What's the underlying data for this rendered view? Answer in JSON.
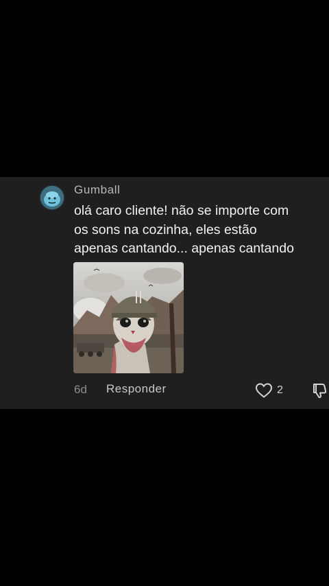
{
  "comment": {
    "username": "Gumball",
    "text_lines": [
      "olá caro cliente! não se importe com",
      "os sons na cozinha, eles estão",
      "apenas cantando... apenas cantando"
    ],
    "time": "6d",
    "reply_label": "Responder",
    "like_count": "2",
    "avatar_icon": "gumball-avatar-icon",
    "image_description_icon": "cat-soldier-meme-image"
  },
  "colors": {
    "background": "#000000",
    "card": "#1f1f1f",
    "text": "#f2f2f2",
    "muted": "#8d8d8d"
  }
}
